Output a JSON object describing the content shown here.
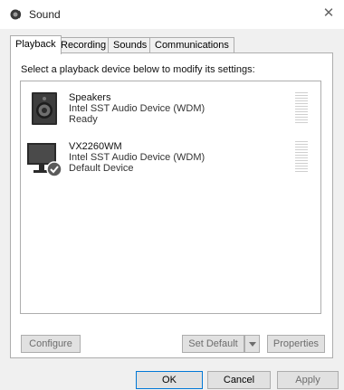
{
  "window": {
    "title": "Sound",
    "icon": "speaker-icon",
    "close_icon": "close-icon"
  },
  "tabs": [
    {
      "label": "Playback",
      "active": true
    },
    {
      "label": "Recording",
      "active": false
    },
    {
      "label": "Sounds",
      "active": false
    },
    {
      "label": "Communications",
      "active": false
    }
  ],
  "playback": {
    "instruction": "Select a playback device below to modify its settings:",
    "devices": [
      {
        "name": "Speakers",
        "description": "Intel SST Audio Device (WDM)",
        "status": "Ready",
        "icon": "speakers-icon",
        "default": false
      },
      {
        "name": "VX2260WM",
        "description": "Intel SST Audio Device (WDM)",
        "status": "Default Device",
        "icon": "monitor-icon",
        "default": true,
        "badge_icon": "default-check-icon"
      }
    ],
    "buttons": {
      "configure": "Configure",
      "set_default": "Set Default",
      "properties": "Properties"
    }
  },
  "footer": {
    "ok": "OK",
    "cancel": "Cancel",
    "apply": "Apply"
  }
}
